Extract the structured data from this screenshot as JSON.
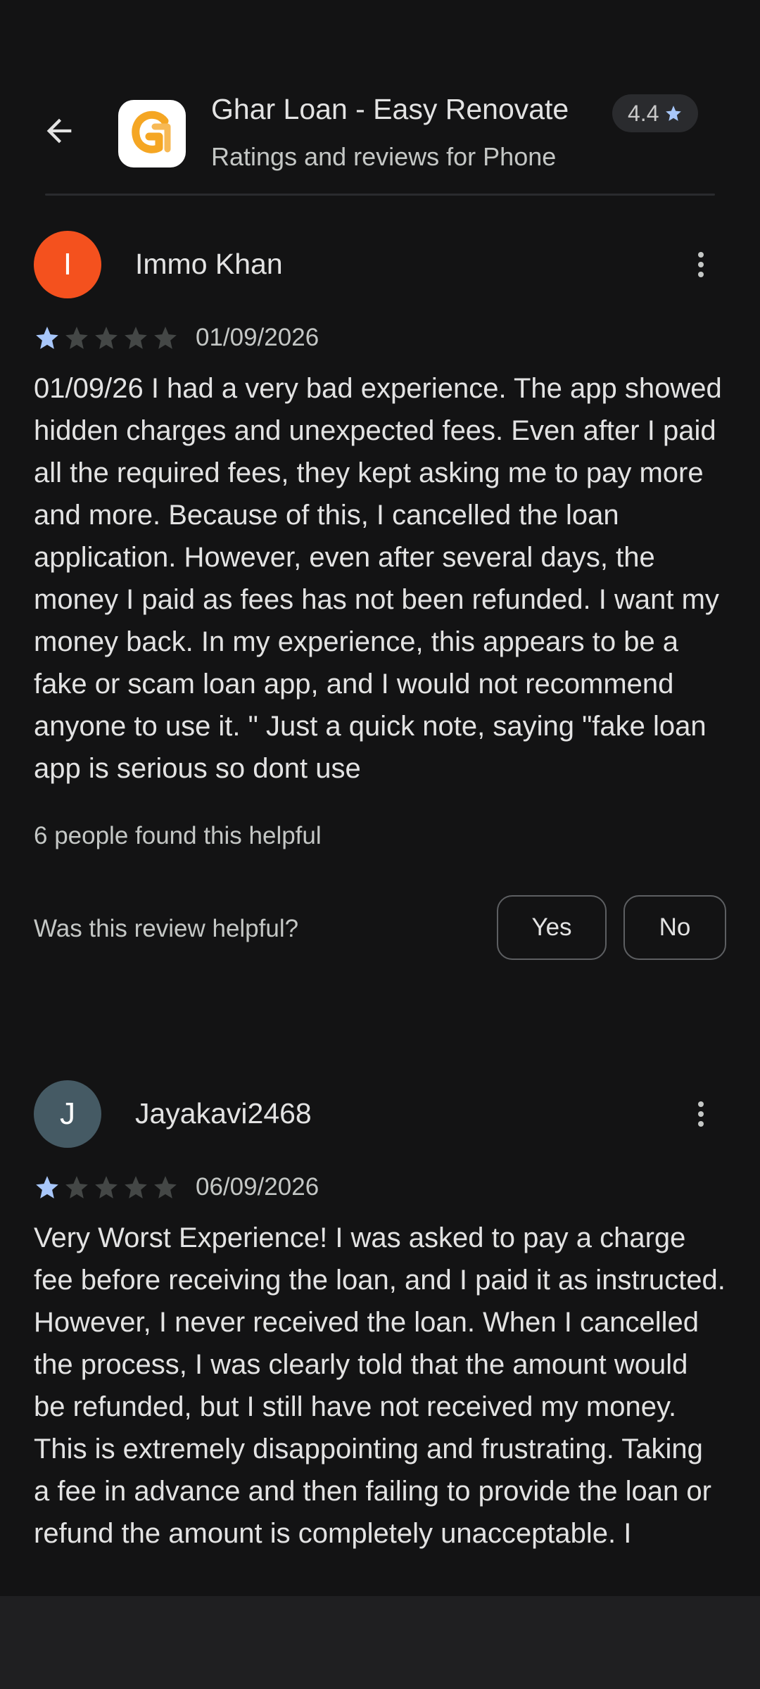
{
  "app": {
    "title": "Ghar Loan - Easy Renovate",
    "rating": "4.4",
    "subtitle": "Ratings and reviews for Phone",
    "icon_letter": "G"
  },
  "colors": {
    "background": "#131314",
    "star_filled": "#a8c7fa",
    "star_empty": "#444746",
    "app_icon_accent": "#f5a623"
  },
  "reviews": [
    {
      "avatar_letter": "I",
      "avatar_color": "#f4511e",
      "name": "Immo Khan",
      "stars": 1,
      "date": "01/09/2026",
      "text": "01/09/26 I had a very bad experience. The app showed hidden charges and unexpected fees. Even after I paid all the required fees, they kept asking me to pay more and more. Because of this, I cancelled the loan application. However, even after several days, the money I paid as fees has not been refunded. I want my money back. In my experience, this appears to be a fake or scam loan app, and I would not recommend anyone to use it. \" Just a quick note, saying \"fake loan app is serious so dont use",
      "helpful_count": "6 people found this helpful",
      "helpful_question": "Was this review helpful?",
      "yes_label": "Yes",
      "no_label": "No"
    },
    {
      "avatar_letter": "J",
      "avatar_color": "#455a64",
      "name": "Jayakavi2468",
      "stars": 1,
      "date": "06/09/2026",
      "text": "Very Worst Experience! I was asked to pay a charge fee before receiving the loan, and I paid it as instructed. However, I never received the loan. When I cancelled the process, I was clearly told that the amount would be refunded, but I still have not received my money. This is extremely disappointing and frustrating. Taking a fee in advance and then failing to provide the loan or refund the amount is completely unacceptable. I"
    }
  ],
  "icons": {
    "back": "arrow-back-icon",
    "more": "more-vert-icon",
    "star": "star-icon"
  }
}
